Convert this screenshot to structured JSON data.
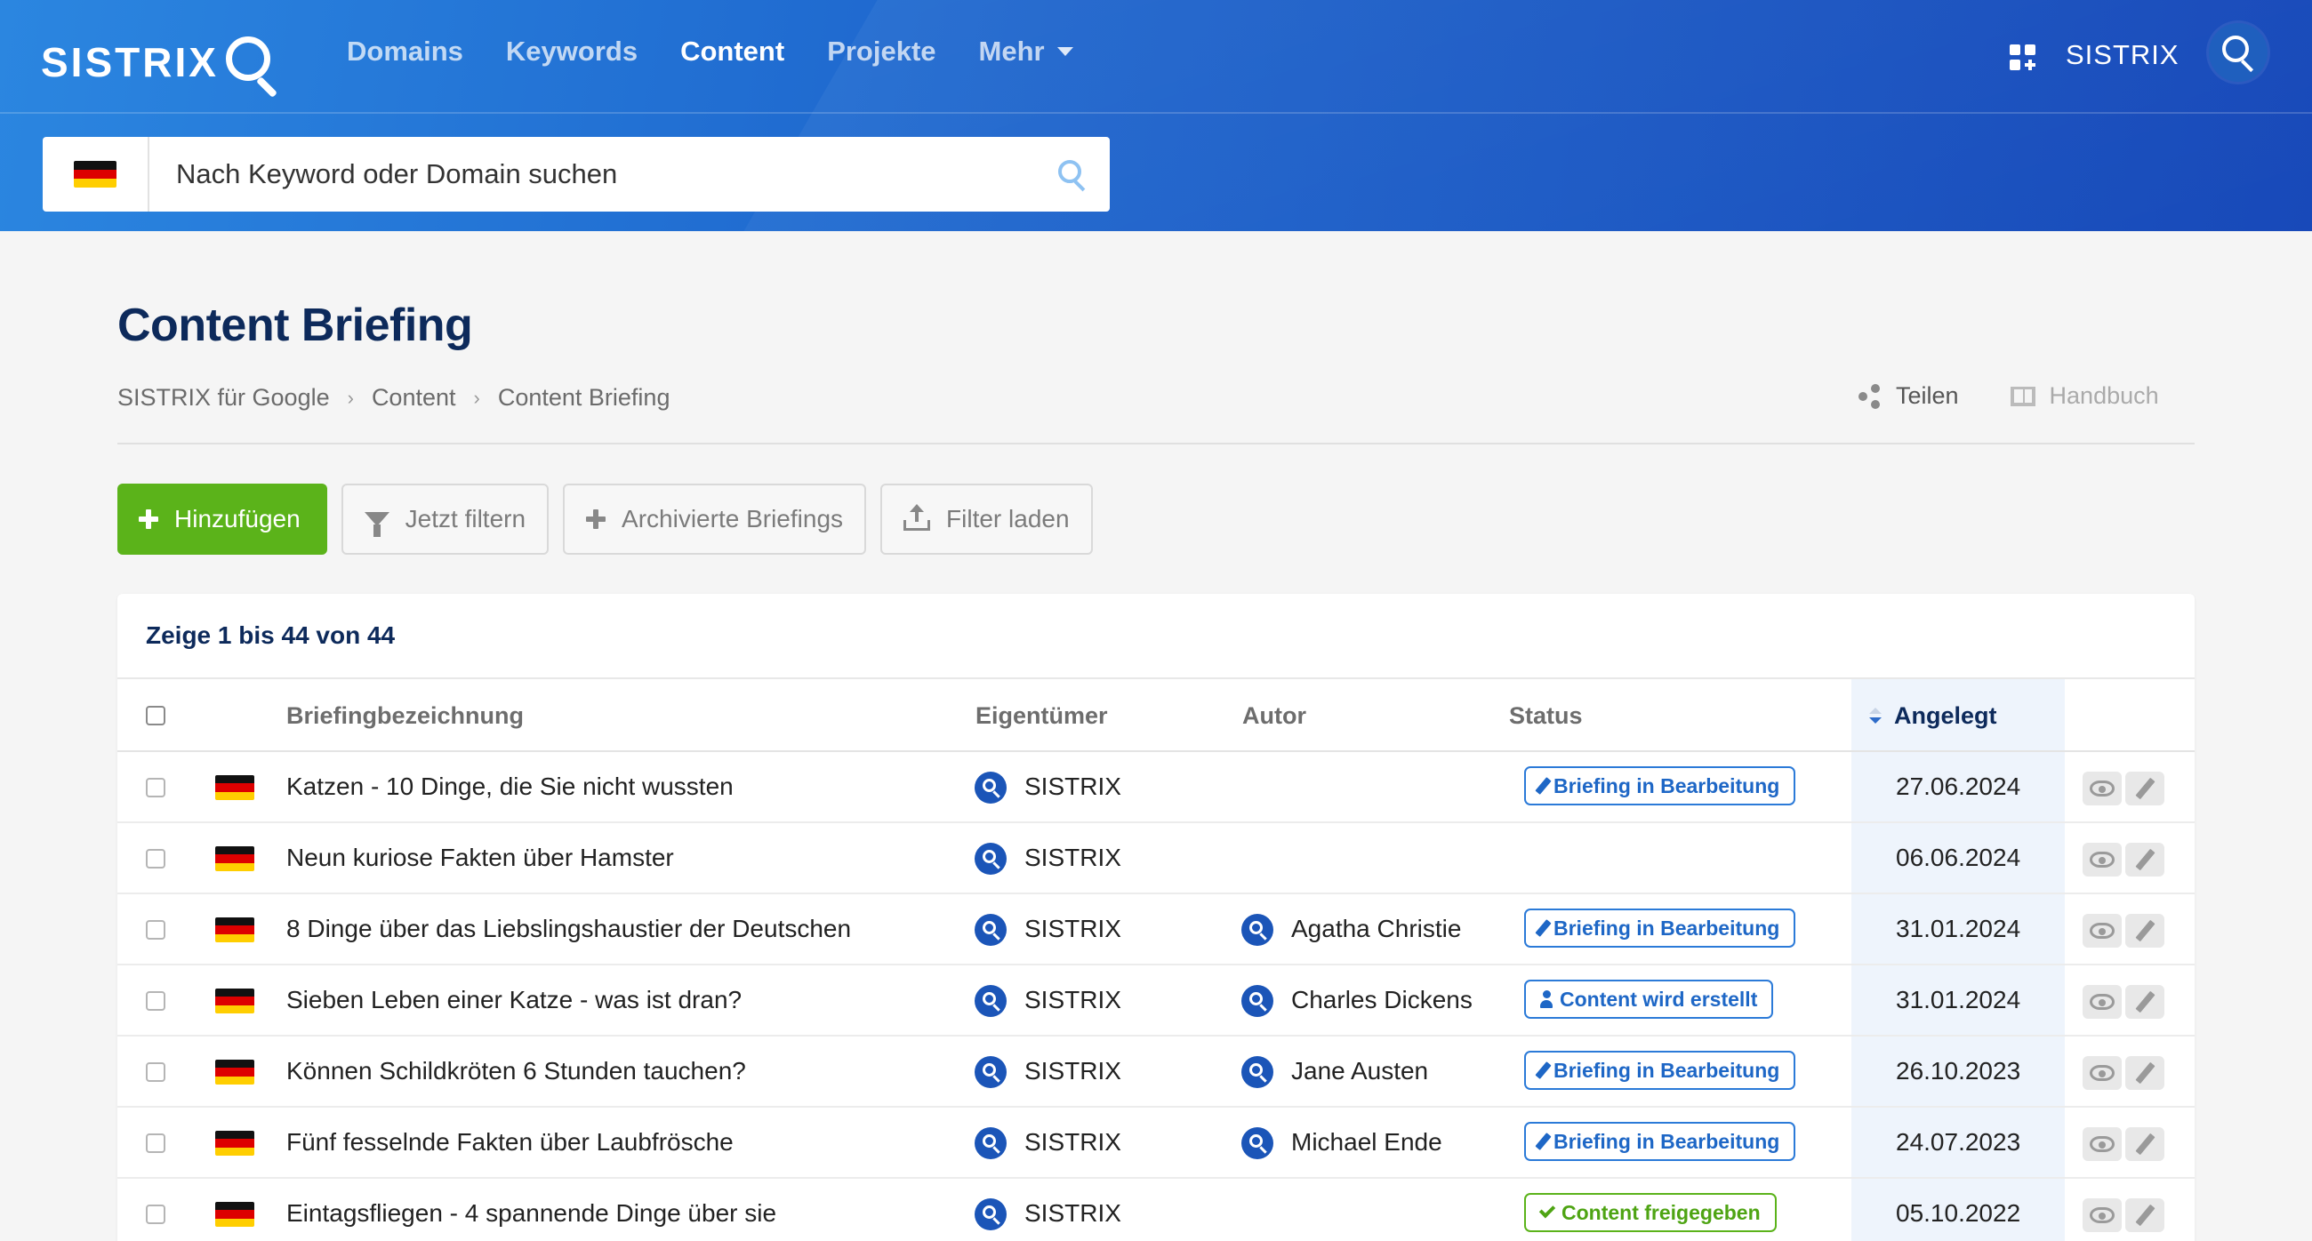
{
  "header": {
    "logo": "SISTRIX",
    "nav": [
      "Domains",
      "Keywords",
      "Content",
      "Projekte",
      "Mehr"
    ],
    "active_nav": "Content",
    "account_name": "SISTRIX",
    "search_placeholder": "Nach Keyword oder Domain suchen",
    "search_country": "Deutschland"
  },
  "page": {
    "title": "Content Briefing",
    "breadcrumb": [
      "SISTRIX für Google",
      "Content",
      "Content Briefing"
    ],
    "share_label": "Teilen",
    "manual_label": "Handbuch"
  },
  "toolbar": {
    "add_label": "Hinzufügen",
    "filter_label": "Jetzt filtern",
    "archived_label": "Archivierte Briefings",
    "load_filter_label": "Filter laden"
  },
  "table": {
    "summary": "Zeige 1 bis 44 von 44",
    "columns": {
      "name": "Briefingbezeichnung",
      "owner": "Eigentümer",
      "author": "Autor",
      "status": "Status",
      "created": "Angelegt"
    },
    "sorted_column": "Angelegt",
    "rows": [
      {
        "name": "Katzen - 10 Dinge, die Sie nicht wussten",
        "owner": "SISTRIX",
        "author": "",
        "status": "Briefing in Bearbeitung",
        "status_type": "edit",
        "created": "27.06.2024"
      },
      {
        "name": "Neun kuriose Fakten über Hamster",
        "owner": "SISTRIX",
        "author": "",
        "status": "",
        "status_type": "",
        "created": "06.06.2024"
      },
      {
        "name": "8 Dinge über das Liebslingshaustier der Deutschen",
        "owner": "SISTRIX",
        "author": "Agatha Christie",
        "status": "Briefing in Bearbeitung",
        "status_type": "edit",
        "created": "31.01.2024"
      },
      {
        "name": "Sieben Leben einer Katze - was ist dran?",
        "owner": "SISTRIX",
        "author": "Charles Dickens",
        "status": "Content wird erstellt",
        "status_type": "person",
        "created": "31.01.2024"
      },
      {
        "name": "Können Schildkröten 6 Stunden tauchen?",
        "owner": "SISTRIX",
        "author": "Jane Austen",
        "status": "Briefing in Bearbeitung",
        "status_type": "edit",
        "created": "26.10.2023"
      },
      {
        "name": "Fünf fesselnde Fakten über Laubfrösche",
        "owner": "SISTRIX",
        "author": "Michael Ende",
        "status": "Briefing in Bearbeitung",
        "status_type": "edit",
        "created": "24.07.2023"
      },
      {
        "name": "Eintagsfliegen - 4 spannende Dinge über sie",
        "owner": "SISTRIX",
        "author": "",
        "status": "Content freigegeben",
        "status_type": "approved",
        "created": "05.10.2022"
      }
    ]
  },
  "colors": {
    "brand_blue": "#1d64cc",
    "primary_green": "#5bb31a",
    "title_navy": "#0d2a5b",
    "badge_blue": "#2b7ad8"
  },
  "icons": [
    "logo-search-icon",
    "apps-grid-icon",
    "search-icon",
    "flag-de-icon",
    "share-icon",
    "book-icon",
    "plus-icon",
    "filter-icon",
    "upload-icon",
    "sort-desc-icon",
    "owner-avatar-icon",
    "pencil-icon",
    "person-icon",
    "check-icon",
    "eye-icon",
    "edit-icon"
  ]
}
